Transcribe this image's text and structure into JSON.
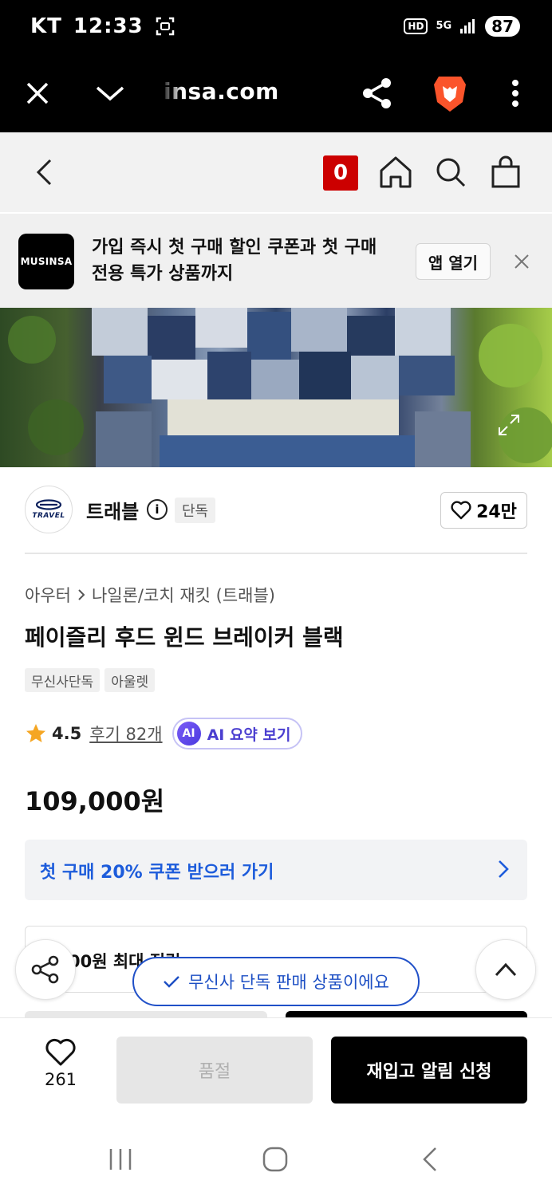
{
  "status_bar": {
    "carrier": "KT",
    "time": "12:33",
    "hd": "HD",
    "network": "5G",
    "battery": "87"
  },
  "browser": {
    "url": "insa.com",
    "icons": [
      "close-icon",
      "chevron-down-icon",
      "share-icon",
      "brave-icon",
      "more-icon"
    ]
  },
  "header": {
    "cart_count": "0",
    "icons": [
      "back-icon",
      "home-icon",
      "search-icon",
      "bag-icon"
    ]
  },
  "promo": {
    "logo": "MUSINSA",
    "line1": "가입 즉시 첫 구매 할인 쿠폰과 첫 구매",
    "line2": "전용 특가 상품까지",
    "button": "앱 열기"
  },
  "brand": {
    "logo_text": "TRAVEL",
    "name": "트래블",
    "info": "i",
    "tag": "단독",
    "likes": "24만"
  },
  "product": {
    "breadcrumb": [
      "아우터",
      "나일론/코치 재킷 (트래블)"
    ],
    "title": "페이즐리 후드 윈드 브레이커 블랙",
    "tags": [
      "무신사단독",
      "아울렛"
    ],
    "rating": "4.5",
    "reviews": "후기 82개",
    "ai_icon": "AI",
    "ai_label": "AI 요약 보기",
    "price": "109,000원"
  },
  "coupon": {
    "text": "첫 구매 20% 쿠폰 받으러 가기"
  },
  "points": {
    "text": "00원 최대 적립"
  },
  "toast": {
    "text": "무신사 단독 판매 상품이에요"
  },
  "action_bar": {
    "wish_count": "261",
    "soldout": "품절",
    "restock": "재입고 알림 신청"
  },
  "colors": {
    "accent_blue": "#1d5cdb",
    "cart_red": "#cc0000",
    "brave_orange": "#fb542b"
  }
}
